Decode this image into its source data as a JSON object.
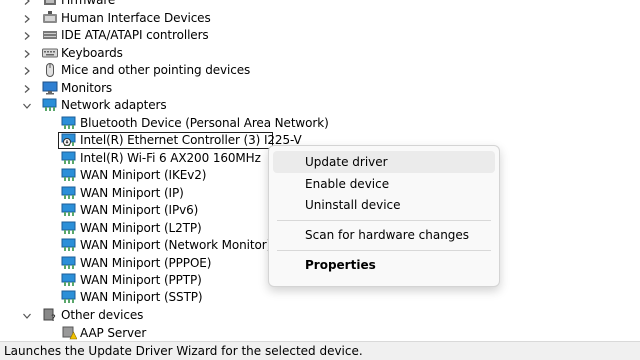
{
  "tree": {
    "categories_top": [
      {
        "label": "Firmware",
        "icon": "firmware-icon"
      },
      {
        "label": "Human Interface Devices",
        "icon": "hid-icon"
      },
      {
        "label": "IDE ATA/ATAPI controllers",
        "icon": "ide-controller-icon"
      },
      {
        "label": "Keyboards",
        "icon": "keyboard-icon"
      },
      {
        "label": "Mice and other pointing devices",
        "icon": "mouse-icon"
      },
      {
        "label": "Monitors",
        "icon": "monitor-icon"
      },
      {
        "label": "Network adapters",
        "icon": "network-adapter-icon",
        "expanded": true
      }
    ],
    "network_devices": [
      {
        "label": "Bluetooth Device (Personal Area Network)"
      },
      {
        "label": "Intel(R) Ethernet Controller (3) I225-V",
        "selected": true
      },
      {
        "label": "Intel(R) Wi-Fi 6 AX200 160MHz"
      },
      {
        "label": "WAN Miniport (IKEv2)"
      },
      {
        "label": "WAN Miniport (IP)"
      },
      {
        "label": "WAN Miniport (IPv6)"
      },
      {
        "label": "WAN Miniport (L2TP)"
      },
      {
        "label": "WAN Miniport (Network Monitor)"
      },
      {
        "label": "WAN Miniport (PPPOE)"
      },
      {
        "label": "WAN Miniport (PPTP)"
      },
      {
        "label": "WAN Miniport (SSTP)"
      }
    ],
    "categories_bottom": [
      {
        "label": "Other devices",
        "icon": "other-devices-icon",
        "expanded": true
      }
    ],
    "other_devices": [
      {
        "label": "AAP Server"
      }
    ]
  },
  "context_menu": {
    "update_driver": "Update driver",
    "enable_device": "Enable device",
    "uninstall_device": "Uninstall device",
    "scan_hardware": "Scan for hardware changes",
    "properties": "Properties"
  },
  "status_bar": {
    "text": "Launches the Update Driver Wizard for the selected device."
  },
  "colors": {
    "menu_hover": "#ebebeb",
    "adapter_icon_blue": "#2b8fd8",
    "status_bg": "#f0f0f0"
  }
}
